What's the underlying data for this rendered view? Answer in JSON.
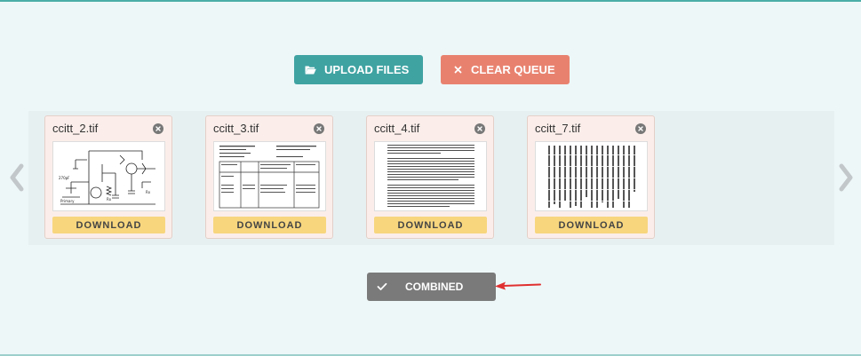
{
  "toolbar": {
    "upload_label": "UPLOAD FILES",
    "clear_label": "CLEAR QUEUE",
    "upload_icon": "folder-open-icon",
    "clear_icon": "close-icon"
  },
  "colors": {
    "upload": "#3fa3a2",
    "clear": "#e8826f",
    "download": "#f7d67e",
    "combined": "#7a7a7a",
    "card": "#fbeeea",
    "accent_line": "#4aaea7",
    "annotation_arrow": "#e03030"
  },
  "queue": {
    "files": [
      {
        "name": "ccitt_2.tif",
        "download_label": "DOWNLOAD",
        "thumbnail": "circuit-schematic"
      },
      {
        "name": "ccitt_3.tif",
        "download_label": "DOWNLOAD",
        "thumbnail": "tabular-form"
      },
      {
        "name": "ccitt_4.tif",
        "download_label": "DOWNLOAD",
        "thumbnail": "text-page"
      },
      {
        "name": "ccitt_7.tif",
        "download_label": "DOWNLOAD",
        "thumbnail": "dense-text-page"
      }
    ],
    "prev_icon": "chevron-left-icon",
    "next_icon": "chevron-right-icon"
  },
  "combined": {
    "label": "COMBINED",
    "icon": "check-icon"
  }
}
